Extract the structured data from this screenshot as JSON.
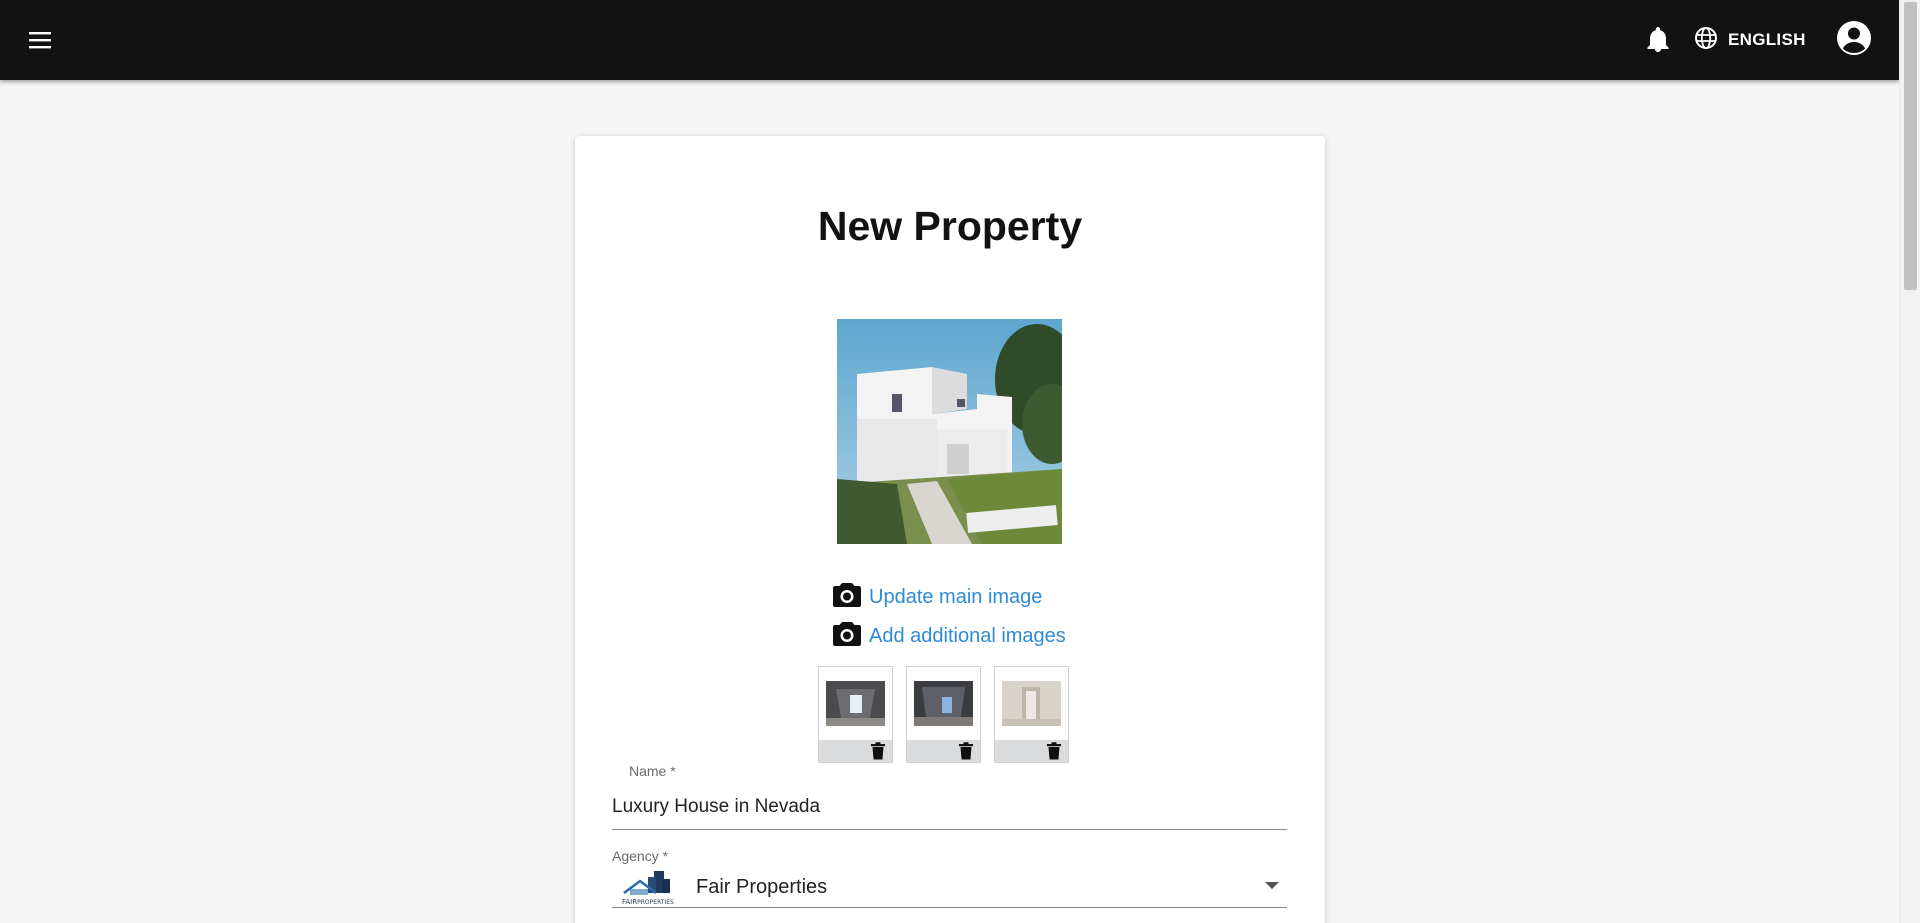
{
  "header": {
    "language_label": "ENGLISH",
    "icons": {
      "menu": "menu-icon",
      "notifications": "bell-icon",
      "language": "globe-icon",
      "account": "account-icon"
    }
  },
  "form": {
    "title": "New Property",
    "update_main_image_label": "Update main image",
    "add_additional_images_label": "Add additional images",
    "name": {
      "label": "Name *",
      "value": "Luxury House in Nevada"
    },
    "agency": {
      "label": "Agency *",
      "value": "Fair Properties",
      "logo_text_1": "FAIR",
      "logo_text_2": "PROPERTIES"
    }
  },
  "colors": {
    "header_bg": "#121212",
    "link": "#2e8bd6",
    "page_bg": "#f5f5f5"
  }
}
